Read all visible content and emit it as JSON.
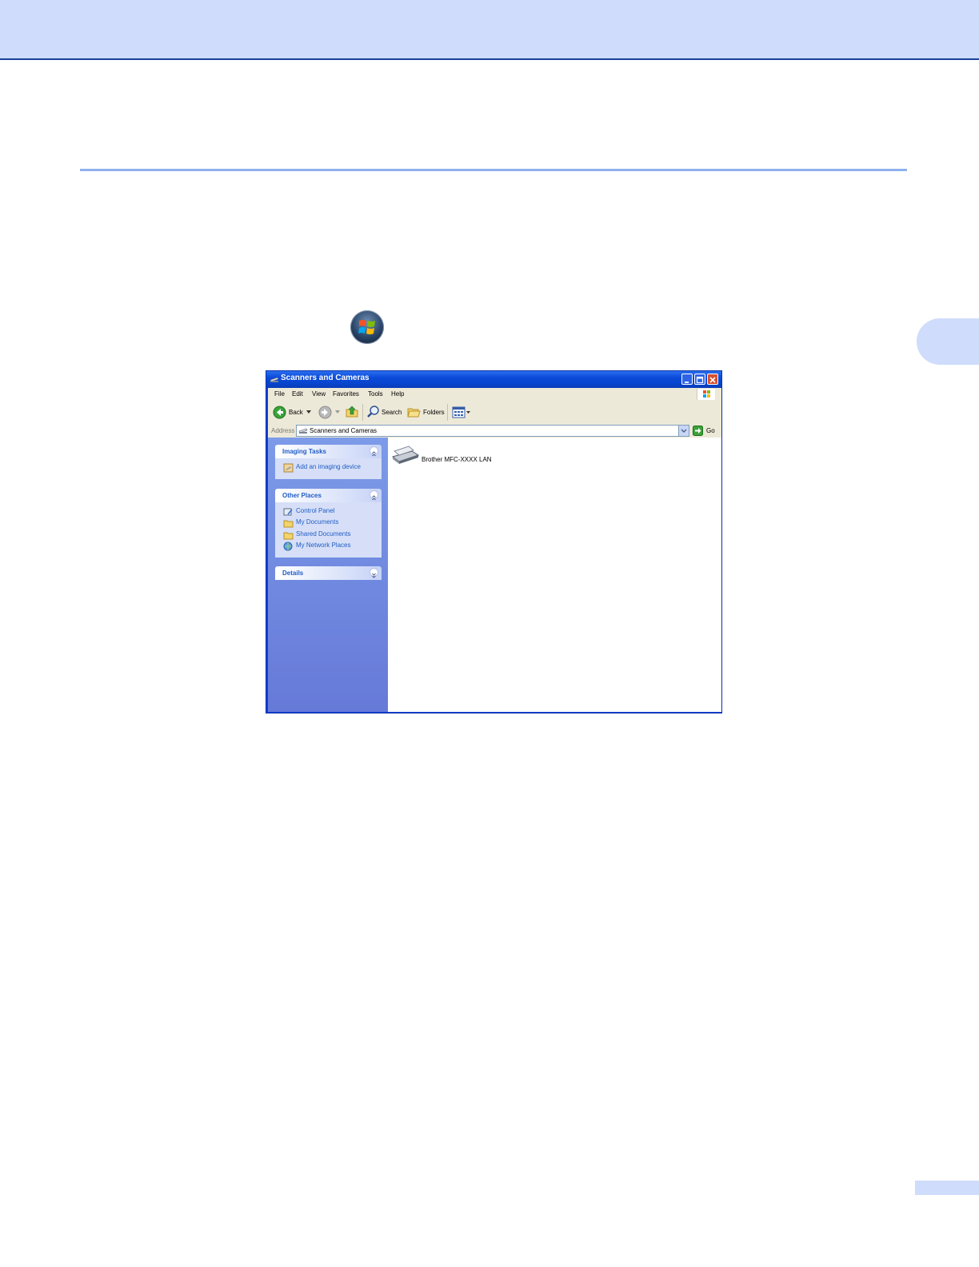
{
  "window": {
    "title": "Scanners and Cameras",
    "menu": [
      "File",
      "Edit",
      "View",
      "Favorites",
      "Tools",
      "Help"
    ],
    "toolbar": {
      "back": "Back",
      "search": "Search",
      "folders": "Folders"
    },
    "address": {
      "label": "Address",
      "value": "Scanners and Cameras",
      "go": "Go"
    },
    "tasks": {
      "imaging": {
        "title": "Imaging Tasks",
        "items": [
          "Add an imaging device"
        ]
      },
      "other": {
        "title": "Other Places",
        "items": [
          "Control Panel",
          "My Documents",
          "Shared Documents",
          "My Network Places"
        ]
      },
      "details": {
        "title": "Details"
      }
    },
    "items": [
      {
        "label": "Brother MFC-XXXX LAN"
      }
    ]
  },
  "icons": {
    "start_orb": "windows-start-orb-icon",
    "scanner": "scanner-icon",
    "back": "back-arrow-icon",
    "forward": "forward-arrow-icon",
    "up": "up-folder-icon",
    "search": "search-magnifier-icon",
    "folders": "folders-icon",
    "views": "views-icon"
  },
  "colors": {
    "page_accent": "#cfdcfb",
    "header_line": "#1b3f9a",
    "titlebar": "#0a4ad8",
    "link": "#215dc6"
  }
}
